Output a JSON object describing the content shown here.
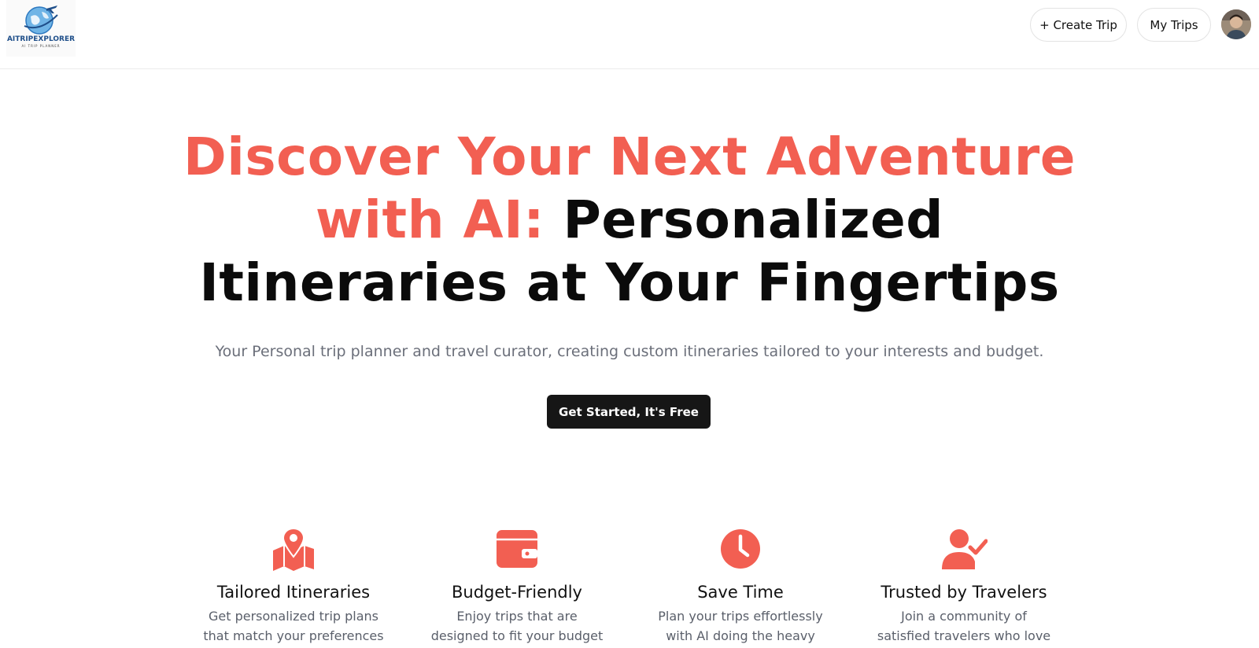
{
  "header": {
    "logo_text": "AITRIPEXPLORER",
    "logo_subtext": "AI TRIP PLANNER",
    "create_trip_label": "+ Create Trip",
    "my_trips_label": "My Trips"
  },
  "hero": {
    "title_highlight": "Discover Your Next Adventure with AI:",
    "title_rest": "Personalized Itineraries at Your Fingertips",
    "subtitle": "Your Personal trip planner and travel curator, creating custom itineraries tailored to your interests and budget.",
    "cta_label": "Get Started, It's Free"
  },
  "features": [
    {
      "icon": "map-pin-icon",
      "title": "Tailored Itineraries",
      "text": "Get personalized trip plans that match your preferences"
    },
    {
      "icon": "wallet-icon",
      "title": "Budget-Friendly",
      "text": "Enjoy trips that are designed to fit your budget without"
    },
    {
      "icon": "clock-icon",
      "title": "Save Time",
      "text": "Plan your trips effortlessly with AI doing the heavy"
    },
    {
      "icon": "user-check-icon",
      "title": "Trusted by Travelers",
      "text": "Join a community of satisfied travelers who love"
    }
  ],
  "colors": {
    "accent": "#f25f52",
    "cta_bg": "#161616",
    "subtitle_gray": "#6b6f7a"
  }
}
